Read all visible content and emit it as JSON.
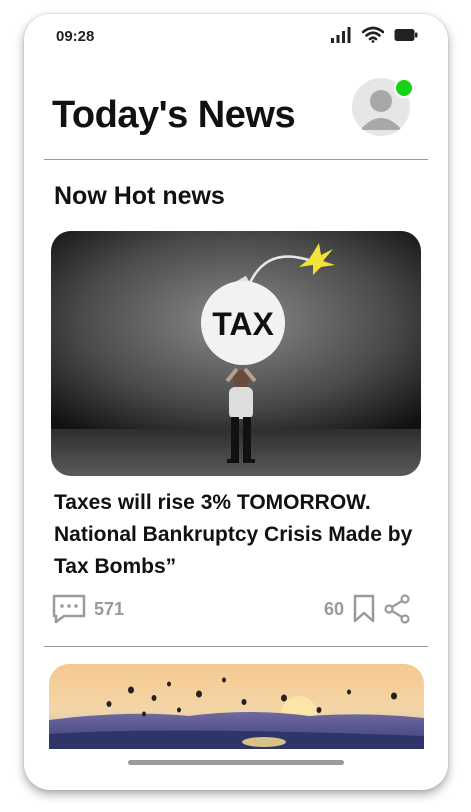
{
  "status_bar": {
    "time": "09:28",
    "signal_icon": "cellular-signal-icon",
    "wifi_icon": "wifi-icon",
    "battery_icon": "battery-icon"
  },
  "header": {
    "title": "Today's News",
    "avatar_icon": "user-avatar-icon",
    "online_status_color": "#17d317"
  },
  "section": {
    "title": "Now Hot news"
  },
  "articles": [
    {
      "image_description_icon": "tax-bomb-image",
      "image_text": "TAX",
      "headline": "Taxes will rise 3% TOMORROW. National Bankruptcy Crisis Made by Tax Bombs”",
      "comment_count": "571",
      "bookmark_count": "60",
      "comment_icon": "comment-icon",
      "bookmark_icon": "bookmark-icon",
      "share_icon": "share-icon"
    },
    {
      "image_description_icon": "balloons-sunrise-image"
    }
  ],
  "colors": {
    "text": "#111111",
    "muted": "#9a9a9a",
    "divider": "#9a9a9a"
  }
}
